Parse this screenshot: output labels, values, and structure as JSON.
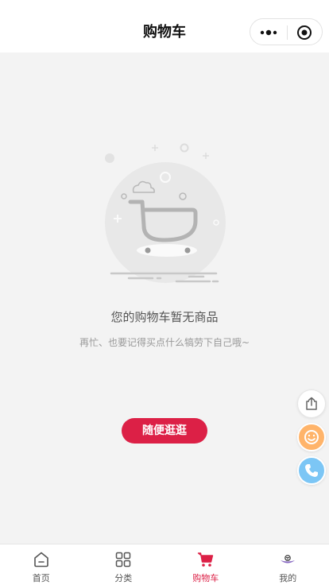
{
  "header": {
    "title": "购物车"
  },
  "capsule": {
    "more_icon": "more-dots-icon",
    "close_icon": "target-icon"
  },
  "empty_state": {
    "title": "您的购物车暂无商品",
    "subtitle": "再忙、也要记得买点什么犒劳下自己哦~",
    "button_label": "随便逛逛",
    "illustration": "empty-cart-illustration"
  },
  "floating_buttons": [
    {
      "name": "share",
      "icon": "share-icon"
    },
    {
      "name": "customer-service",
      "icon": "smiley-icon"
    },
    {
      "name": "phone",
      "icon": "phone-icon"
    }
  ],
  "tab_bar": {
    "active_index": 2,
    "items": [
      {
        "label": "首页",
        "icon": "home-icon"
      },
      {
        "label": "分类",
        "icon": "grid-icon"
      },
      {
        "label": "购物车",
        "icon": "cart-icon"
      },
      {
        "label": "我的",
        "icon": "profile-icon"
      }
    ]
  },
  "colors": {
    "accent": "#dc2046",
    "background": "#f3f3f3",
    "float_service": "#ffb46a",
    "float_phone": "#7cc6f5"
  }
}
